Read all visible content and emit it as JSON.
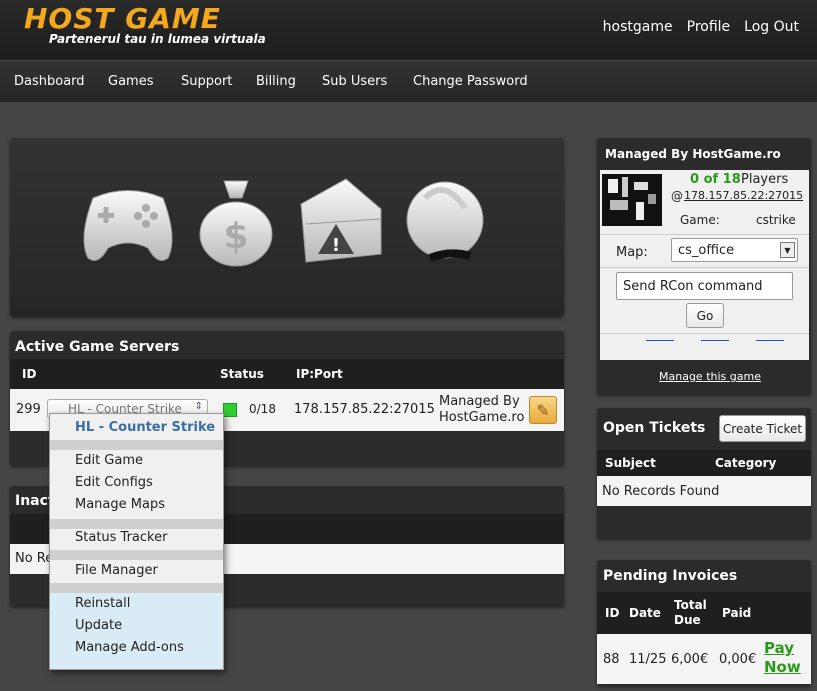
{
  "header": {
    "logo_text": "HOST GAME",
    "tagline": "Partenerul tau in lumea virtuala",
    "username": "hostgame",
    "profile": "Profile",
    "logout": "Log Out"
  },
  "nav": [
    "Dashboard",
    "Games",
    "Support",
    "Billing",
    "Sub Users",
    "Change Password"
  ],
  "active_servers": {
    "title": "Active Game Servers",
    "columns": {
      "id": "ID",
      "status": "Status",
      "ipport": "IP:Port"
    },
    "row": {
      "id": "299",
      "game": "HL - Counter Strike",
      "players": "0/18",
      "ipport": "178.157.85.22:27015",
      "managed_line1": "Managed By",
      "managed_line2": "HostGame.ro"
    }
  },
  "inactive_servers": {
    "title": "Inactive",
    "no_records": "No Records Found"
  },
  "menu": {
    "header": "HL - Counter Strike",
    "items": [
      "Edit Game",
      "Edit Configs",
      "Manage Maps",
      "Status Tracker",
      "File Manager",
      "Reinstall",
      "Update",
      "Manage Add-ons"
    ]
  },
  "managed": {
    "title": "Managed By HostGame.ro",
    "players_count": "0 of 18",
    "players_label": "Players",
    "at": "@",
    "address": "178.157.85.22:27015",
    "game_label": "Game:",
    "game_value": "cstrike",
    "map_label": "Map:",
    "map_value": "cs_office",
    "rcon_placeholder": "Send RCon command",
    "go": "Go",
    "manage_link": "Manage this game"
  },
  "tickets": {
    "title": "Open Tickets",
    "create": "Create Ticket",
    "col_subject": "Subject",
    "col_category": "Category",
    "no_records": "No Records Found"
  },
  "invoices": {
    "title": "Pending Invoices",
    "col_id": "ID",
    "col_date": "Date",
    "col_total_1": "Total",
    "col_total_2": "Due",
    "col_paid": "Paid",
    "row": {
      "id": "88",
      "date": "11/25",
      "total": "6,00€",
      "paid": "0,00€",
      "pay1": "Pay",
      "pay2": "Now"
    }
  },
  "colors": {
    "accent": "#f5a81c",
    "green": "#2a9a1a"
  }
}
